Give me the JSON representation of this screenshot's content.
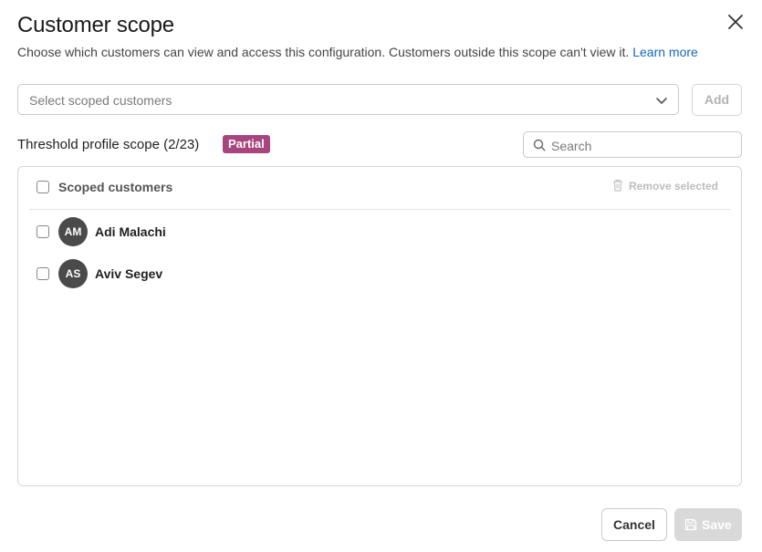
{
  "dialog": {
    "title": "Customer scope",
    "subtitle": "Choose which customers can view and access this configuration. Customers outside this scope can't view it.",
    "learn_more": "Learn more"
  },
  "selector": {
    "placeholder": "Select scoped customers",
    "add_label": "Add"
  },
  "scope": {
    "title": "Threshold profile scope (2/23)",
    "badge": "Partial",
    "badge_color": "#a8457e",
    "search_placeholder": "Search"
  },
  "list": {
    "header_label": "Scoped customers",
    "remove_label": "Remove selected",
    "items": [
      {
        "initials": "AM",
        "name": "Adi Malachi"
      },
      {
        "initials": "AS",
        "name": "Aviv Segev"
      }
    ]
  },
  "footer": {
    "cancel_label": "Cancel",
    "save_label": "Save"
  }
}
